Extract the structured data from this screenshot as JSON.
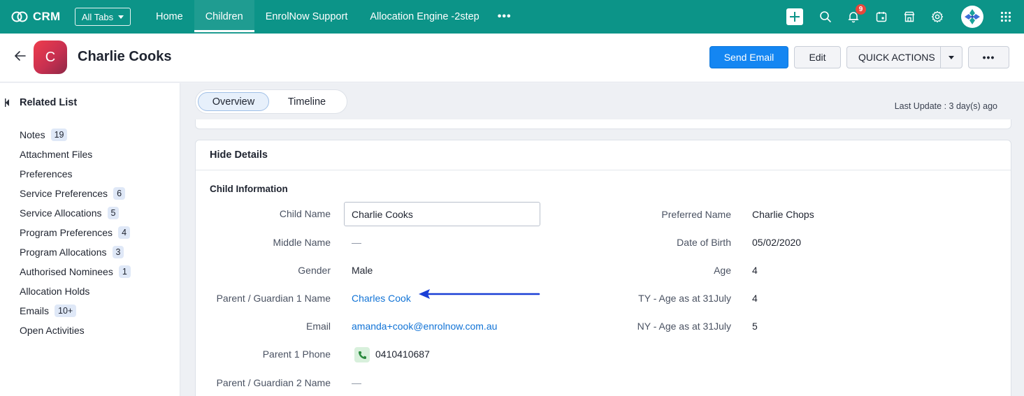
{
  "app": {
    "name": "CRM"
  },
  "nav": {
    "all_tabs_label": "All Tabs",
    "tabs": [
      {
        "label": "Home",
        "active": false
      },
      {
        "label": "Children",
        "active": true
      },
      {
        "label": "EnrolNow Support",
        "active": false
      },
      {
        "label": "Allocation Engine -2step",
        "active": false
      }
    ],
    "more_label": "•••",
    "notification_count": "9"
  },
  "record": {
    "avatar_initial": "C",
    "name": "Charlie Cooks",
    "actions": {
      "send_email": "Send Email",
      "edit": "Edit",
      "quick_actions": "QUICK ACTIONS",
      "more": "•••"
    }
  },
  "related_list": {
    "title": "Related List",
    "items": [
      {
        "label": "Notes",
        "count": "19"
      },
      {
        "label": "Attachment Files",
        "count": ""
      },
      {
        "label": "Preferences",
        "count": ""
      },
      {
        "label": "Service Preferences",
        "count": "6"
      },
      {
        "label": "Service Allocations",
        "count": "5"
      },
      {
        "label": "Program Preferences",
        "count": "4"
      },
      {
        "label": "Program Allocations",
        "count": "3"
      },
      {
        "label": "Authorised Nominees",
        "count": "1"
      },
      {
        "label": "Allocation Holds",
        "count": ""
      },
      {
        "label": "Emails",
        "count": "10+"
      },
      {
        "label": "Open Activities",
        "count": ""
      }
    ]
  },
  "view_tabs": {
    "overview": "Overview",
    "timeline": "Timeline"
  },
  "last_update": "Last Update : 3 day(s) ago",
  "details": {
    "toggle_label": "Hide Details",
    "section_title": "Child Information",
    "left_fields": {
      "child_name": {
        "label": "Child Name",
        "value": "Charlie Cooks"
      },
      "middle_name": {
        "label": "Middle Name",
        "value": "—"
      },
      "gender": {
        "label": "Gender",
        "value": "Male"
      },
      "parent1_name": {
        "label": "Parent / Guardian 1 Name",
        "value": "Charles Cook"
      },
      "email": {
        "label": "Email",
        "value": "amanda+cook@enrolnow.com.au"
      },
      "parent1_phone": {
        "label": "Parent 1 Phone",
        "value": "0410410687"
      },
      "parent2_name": {
        "label": "Parent / Guardian 2 Name",
        "value": "—"
      }
    },
    "right_fields": {
      "preferred_name": {
        "label": "Preferred Name",
        "value": "Charlie Chops"
      },
      "dob": {
        "label": "Date of Birth",
        "value": "05/02/2020"
      },
      "age": {
        "label": "Age",
        "value": "4"
      },
      "ty_age": {
        "label": "TY - Age as at 31July",
        "value": "4"
      },
      "ny_age": {
        "label": "NY - Age as at 31July",
        "value": "5"
      }
    }
  },
  "colors": {
    "nav_bg": "#0c9488",
    "primary_button": "#1486f2",
    "link": "#1173d6",
    "annotation_arrow": "#1a3fd6"
  }
}
